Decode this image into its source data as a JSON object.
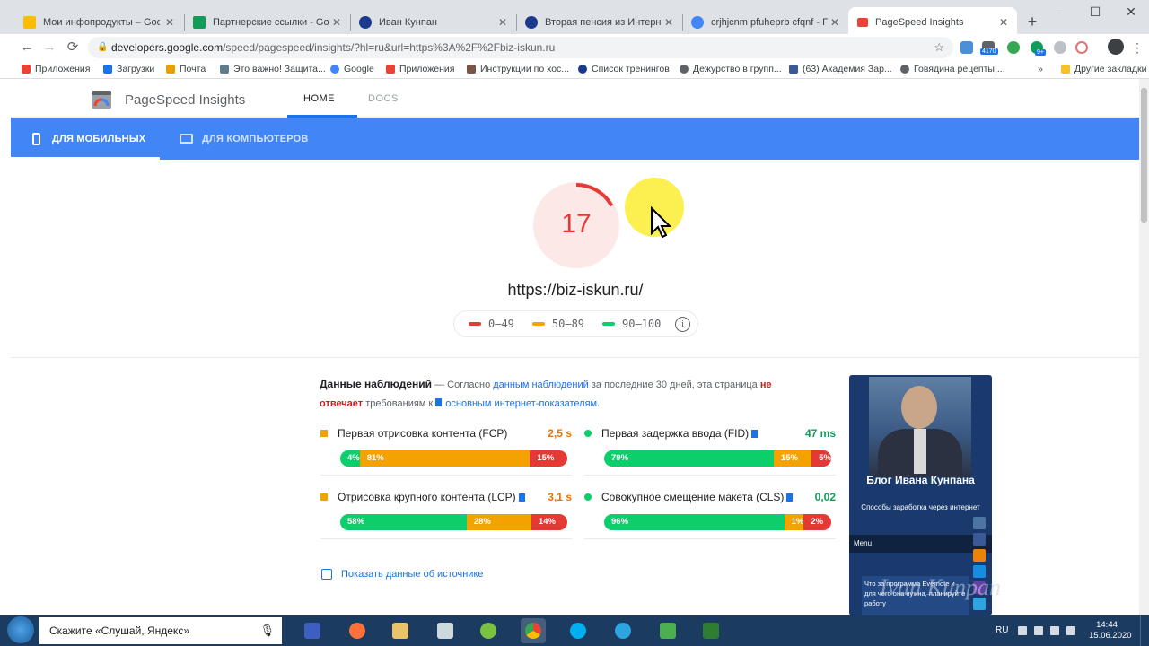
{
  "browser": {
    "tabs": [
      {
        "title": "Мои инфопродукты – Google",
        "icon_color": "#fbbc04",
        "active": false
      },
      {
        "title": "Партнерские ссылки - Google",
        "icon_color": "#0f9d58",
        "active": false
      },
      {
        "title": "Иван Кунпан",
        "icon_color": "#1a3a8f",
        "active": false
      },
      {
        "title": "Вторая пенсия из Интернета",
        "icon_color": "#1a3a8f",
        "active": false
      },
      {
        "title": "crjhjcnm pfuheprb cfqnf - Поис",
        "icon_color": "#4285f4",
        "active": false
      },
      {
        "title": "PageSpeed Insights",
        "icon_color": "#ea4335",
        "active": true
      }
    ],
    "tab_close": "✕",
    "new_tab": "+",
    "window_controls": {
      "minimize": "–",
      "maximize": "☐",
      "close": "✕"
    },
    "nav": {
      "back": "←",
      "forward": "→",
      "reload": "⟳"
    },
    "address": {
      "domain": "developers.google.com",
      "path": "/speed/pagespeed/insights/?hl=ru&url=https%3A%2F%2Fbiz-iskun.ru",
      "lock": "🔒",
      "star": "☆"
    },
    "extensions": {
      "badge1": "4170",
      "badge2": "9+"
    },
    "bookmarks": [
      {
        "label": "Приложения",
        "icon_color": "#ea4335"
      },
      {
        "label": "Загрузки",
        "icon_color": "#1a73e8"
      },
      {
        "label": "Почта",
        "icon_color": "#e6a100"
      },
      {
        "label": "Это важно! Защита...",
        "icon_color": "#607d8b"
      },
      {
        "label": "Google",
        "icon_color": "#4285f4"
      },
      {
        "label": "Приложения",
        "icon_color": "#ea4335"
      },
      {
        "label": "Инструкции по хос...",
        "icon_color": "#795548"
      },
      {
        "label": "Список тренингов",
        "icon_color": "#1a3a8f"
      },
      {
        "label": "Дежурство в групп...",
        "icon_color": "#5f6368"
      },
      {
        "label": "(63) Академия Зар...",
        "icon_color": "#3b5998"
      },
      {
        "label": "Говядина рецепты,...",
        "icon_color": "#5f6368"
      }
    ],
    "bookmarks_more": "»",
    "other_bookmarks": "Другие закладки"
  },
  "psi": {
    "title": "PageSpeed Insights",
    "nav_home": "HOME",
    "nav_docs": "DOCS",
    "tab_mobile": "ДЛЯ МОБИЛЬНЫХ",
    "tab_desktop": "ДЛЯ КОМПЬЮТЕРОВ",
    "score": "17",
    "score_fraction": 0.17,
    "score_color": "#e53935",
    "url": "https://biz-iskun.ru/",
    "legend": [
      {
        "label": "0–49",
        "color": "#e53935"
      },
      {
        "label": "50–89",
        "color": "#f4a200"
      },
      {
        "label": "90–100",
        "color": "#0cce6b"
      }
    ],
    "legend_info": "i",
    "field": {
      "heading": "Данные наблюдений",
      "dash": " — Согласно ",
      "link1": "данным наблюдений",
      "mid": " за последние 30 дней, эта страница ",
      "not": "не отвечает",
      "mid2": " требованиям к ",
      "link2": "основным интернет-показателям",
      "end": "."
    },
    "metrics": [
      {
        "label": "Первая отрисовка контента (FCP)",
        "value": "2,5 s",
        "value_color": "#e8710a",
        "mark": "square",
        "mark_color": "#f4a200",
        "flag": false,
        "segments": [
          {
            "pct": "4%",
            "share": 4,
            "color": "#0cce6b"
          },
          {
            "pct": "81%",
            "share": 81,
            "color": "#f4a200"
          },
          {
            "pct": "15%",
            "share": 15,
            "color": "#e53935"
          }
        ]
      },
      {
        "label": "Первая задержка ввода (FID)",
        "value": "47 ms",
        "value_color": "#0f9d58",
        "mark": "circle",
        "mark_color": "#0cce6b",
        "flag": true,
        "segments": [
          {
            "pct": "79%",
            "share": 79,
            "color": "#0cce6b"
          },
          {
            "pct": "15%",
            "share": 15,
            "color": "#f4a200"
          },
          {
            "pct": "5%",
            "share": 6,
            "color": "#e53935"
          }
        ]
      },
      {
        "label": "Отрисовка крупного контента (LCP)",
        "value": "3,1 s",
        "value_color": "#e8710a",
        "mark": "square",
        "mark_color": "#f4a200",
        "flag": true,
        "segments": [
          {
            "pct": "58%",
            "share": 58,
            "color": "#0cce6b"
          },
          {
            "pct": "28%",
            "share": 28,
            "color": "#f4a200"
          },
          {
            "pct": "14%",
            "share": 14,
            "color": "#e53935"
          }
        ]
      },
      {
        "label": "Совокупное смещение макета (CLS)",
        "value": "0,02",
        "value_color": "#0f9d58",
        "mark": "circle",
        "mark_color": "#0cce6b",
        "flag": true,
        "segments": [
          {
            "pct": "96%",
            "share": 85,
            "color": "#0cce6b"
          },
          {
            "pct": "1%",
            "share": 5,
            "color": "#f4a200"
          },
          {
            "pct": "2%",
            "share": 10,
            "color": "#e53935"
          }
        ]
      }
    ],
    "show_source": "Показать данные об источнике",
    "thumbnail": {
      "blog_title": "Блог Ивана Кунпана",
      "blog_sub": "Способы заработка через интернет",
      "menu": "Menu",
      "box_text": "Что за программа Evernote и для чего она нужна, планируйте работу",
      "watermark": "Ivan Kunpan"
    }
  },
  "taskbar": {
    "search_placeholder": "Скажите «Слушай, Яндекс»",
    "mic": "🎙",
    "lang": "RU",
    "time": "14:44",
    "date": "15.06.2020"
  }
}
